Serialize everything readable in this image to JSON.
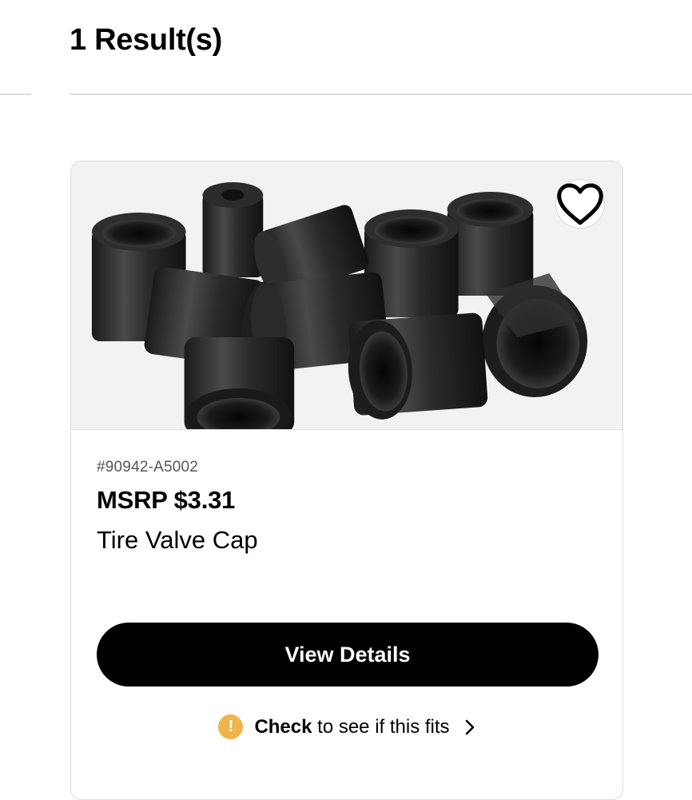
{
  "results": {
    "heading": "1 Result(s)"
  },
  "product": {
    "part_number": "#90942-A5002",
    "price": "MSRP $3.31",
    "name": "Tire Valve Cap",
    "image_alt": "Tire Valve Cap",
    "view_details_label": "View Details",
    "fit_check": {
      "strong": "Check",
      "text": " to see if this fits",
      "icon": "warning-icon",
      "chevron": "chevron-right-icon"
    },
    "favorite_icon": "heart-icon"
  },
  "colors": {
    "divider": "#dedede",
    "card_border": "#dcdcdc",
    "button_bg": "#000000",
    "warning": "#f0b44a"
  }
}
